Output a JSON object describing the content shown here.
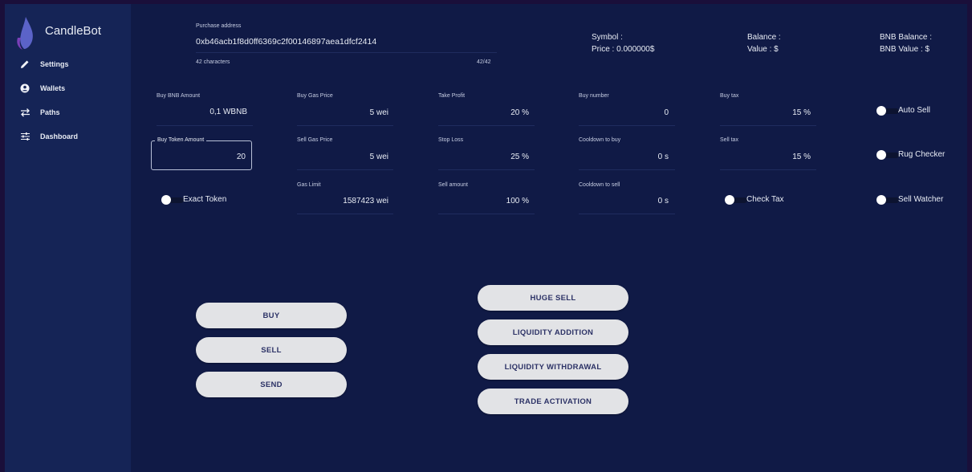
{
  "sidebar": {
    "brand": "CandleBot",
    "items": [
      {
        "label": "Settings",
        "icon": "pencil-icon"
      },
      {
        "label": "Wallets",
        "icon": "account-icon"
      },
      {
        "label": "Paths",
        "icon": "swap-arrows-icon"
      },
      {
        "label": "Dashboard",
        "icon": "sliders-icon"
      }
    ]
  },
  "address": {
    "label": "Purchase address",
    "value": "0xb46acb1f8d0ff6369c2f00146897aea1dfcf2414",
    "helper": "42 characters",
    "counter": "42/42"
  },
  "info": {
    "symbol": "Symbol :",
    "price": "Price : 0.000000$",
    "balance": "Balance :",
    "value": "Value : $",
    "bnb_balance": "BNB Balance :",
    "bnb_value": "BNB Value : $"
  },
  "fields": {
    "buy_bnb_amount": {
      "label": "Buy BNB Amount",
      "value": "0,1 WBNB"
    },
    "buy_token_amount": {
      "label": "Buy Token Amount",
      "value": "20"
    },
    "buy_gas_price": {
      "label": "Buy Gas Price",
      "value": "5 wei"
    },
    "sell_gas_price": {
      "label": "Sell Gas Price",
      "value": "5 wei"
    },
    "gas_limit": {
      "label": "Gas Limit",
      "value": "1587423 wei"
    },
    "take_profit": {
      "label": "Take Profit",
      "value": "20 %"
    },
    "stop_loss": {
      "label": "Stop Loss",
      "value": "25 %"
    },
    "sell_amount": {
      "label": "Sell amount",
      "value": "100 %"
    },
    "buy_number": {
      "label": "Buy number",
      "value": "0"
    },
    "cooldown_buy": {
      "label": "Cooldown to buy",
      "value": "0 s"
    },
    "cooldown_sell": {
      "label": "Cooldown to sell",
      "value": "0 s"
    },
    "buy_tax": {
      "label": "Buy tax",
      "value": "15 %"
    },
    "sell_tax": {
      "label": "Sell tax",
      "value": "15 %"
    }
  },
  "toggles": {
    "exact_token": "Exact Token",
    "check_tax": "Check Tax",
    "auto_sell": "Auto Sell",
    "rug_checker": "Rug Checker",
    "sell_watcher": "Sell Watcher"
  },
  "buttons": {
    "buy": "BUY",
    "sell": "SELL",
    "send": "SEND",
    "huge_sell": "HUGE SELL",
    "liquidity_addition": "LIQUIDITY ADDITION",
    "liquidity_withdrawal": "LIQUIDITY WITHDRAWAL",
    "trade_activation": "TRADE ACTIVATION"
  },
  "colors": {
    "background": "#101a46",
    "sidebar": "#152456",
    "button": "#e2e3e6",
    "button_text": "#2c3266"
  }
}
